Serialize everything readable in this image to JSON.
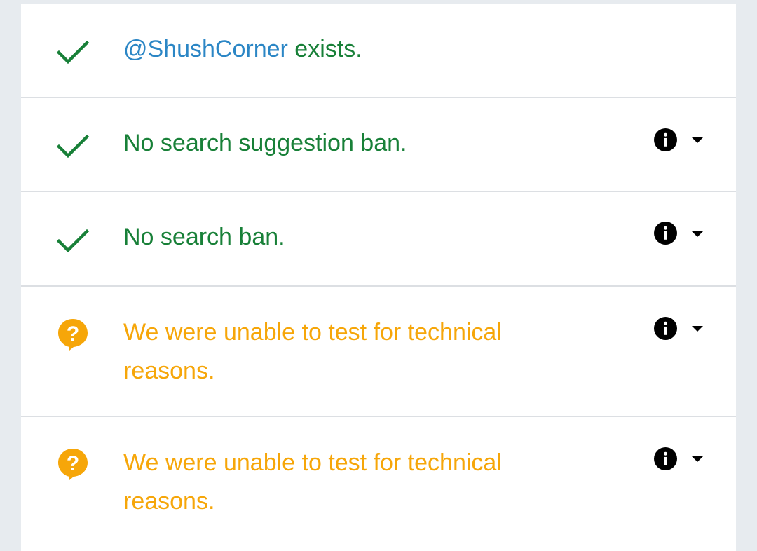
{
  "colors": {
    "ok": "#188038",
    "warn": "#f6a609",
    "handle": "#2b86c5",
    "divider": "#dcdfe3",
    "background": "#e7ebef"
  },
  "rows": [
    {
      "status": "ok",
      "icon": "check-icon",
      "handle": "@ShushCorner",
      "text": " exists.",
      "has_details": false
    },
    {
      "status": "ok",
      "icon": "check-icon",
      "text": "No search suggestion ban.",
      "has_details": true,
      "details_icons": [
        "info-icon",
        "chevron-down-icon"
      ]
    },
    {
      "status": "ok",
      "icon": "check-icon",
      "text": "No search ban.",
      "has_details": true,
      "details_icons": [
        "info-icon",
        "chevron-down-icon"
      ]
    },
    {
      "status": "warn",
      "icon": "question-bubble-icon",
      "text": "We were unable to test for technical reasons.",
      "has_details": true,
      "details_icons": [
        "info-icon",
        "chevron-down-icon"
      ]
    },
    {
      "status": "warn",
      "icon": "question-bubble-icon",
      "text": "We were unable to test for technical reasons.",
      "has_details": true,
      "details_icons": [
        "info-icon",
        "chevron-down-icon"
      ]
    }
  ]
}
